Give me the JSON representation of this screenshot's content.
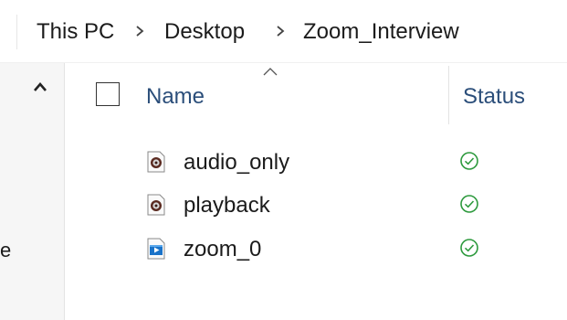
{
  "breadcrumb": {
    "items": [
      {
        "label": "This PC"
      },
      {
        "label": "Desktop"
      },
      {
        "label": "Zoom_Interview"
      }
    ]
  },
  "left_pane": {
    "clipped_text": "e"
  },
  "columns": {
    "name": "Name",
    "status": "Status",
    "sorted_by": "Name"
  },
  "files": [
    {
      "name": "audio_only",
      "icon": "audio-file-icon",
      "status": "synced-check-icon"
    },
    {
      "name": "playback",
      "icon": "audio-file-icon",
      "status": "synced-check-icon"
    },
    {
      "name": "zoom_0",
      "icon": "video-file-icon",
      "status": "synced-check-icon"
    }
  ],
  "colors": {
    "header_text": "#2b4e7a",
    "status_green": "#2e9a3e",
    "video_blue": "#1a73c9",
    "audio_dark": "#5a2a20"
  }
}
